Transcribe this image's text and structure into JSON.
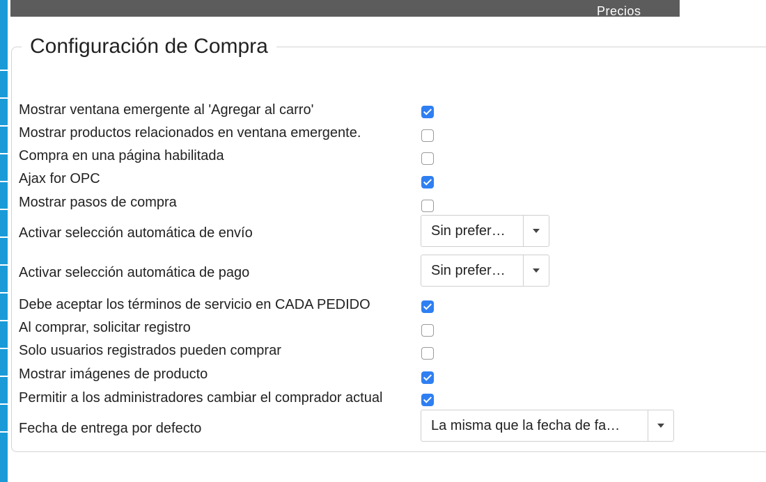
{
  "header": {
    "tab_label": "Precios"
  },
  "section": {
    "title": "Configuración de Compra"
  },
  "settings": [
    {
      "label": "Mostrar ventana emergente al 'Agregar al carro'",
      "checked": true
    },
    {
      "label": "Mostrar productos relacionados en ventana emergente.",
      "checked": false
    },
    {
      "label": "Compra en una página habilitada",
      "checked": false
    },
    {
      "label": "Ajax for OPC",
      "checked": true
    },
    {
      "label": "Mostrar pasos de compra",
      "checked": false
    },
    {
      "label": "Activar selección automática de envío",
      "value": "Sin prefer…"
    },
    {
      "label": "Activar selección automática de pago",
      "value": "Sin prefer…"
    },
    {
      "label": "Debe aceptar los términos de servicio en CADA PEDIDO",
      "checked": true
    },
    {
      "label": "Al comprar, solicitar registro",
      "checked": false
    },
    {
      "label": "Solo usuarios registrados pueden comprar",
      "checked": false
    },
    {
      "label": "Mostrar imágenes de producto",
      "checked": true
    },
    {
      "label": "Permitir a los administradores cambiar el comprador actual",
      "checked": true
    },
    {
      "label": "Fecha de entrega por defecto",
      "value": "La misma que la fecha de fa…"
    }
  ],
  "colors": {
    "accent": "#2f7ff2",
    "topbar": "#5c5c5c",
    "side_accent": "#1a9bd8"
  }
}
